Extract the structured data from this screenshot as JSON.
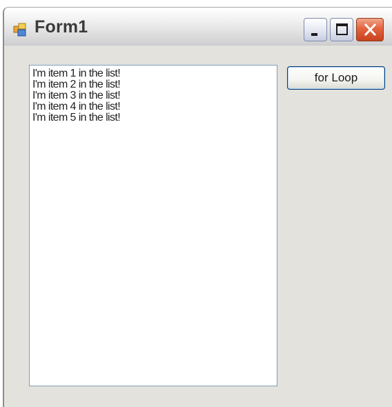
{
  "window": {
    "title": "Form1"
  },
  "listbox": {
    "items": [
      "I'm item 1 in the list!",
      "I'm item 2 in the list!",
      "I'm item 3 in the list!",
      "I'm item 4 in the list!",
      "I'm item 5 in the list!"
    ]
  },
  "button": {
    "label": "for Loop"
  },
  "colors": {
    "form_background": "#e3e2dd",
    "close_button": "#e2643e",
    "listbox_border": "#7f9db9"
  },
  "icons": {
    "app": "form-app-icon",
    "minimize": "minimize-icon",
    "maximize": "maximize-icon",
    "close": "close-icon"
  }
}
